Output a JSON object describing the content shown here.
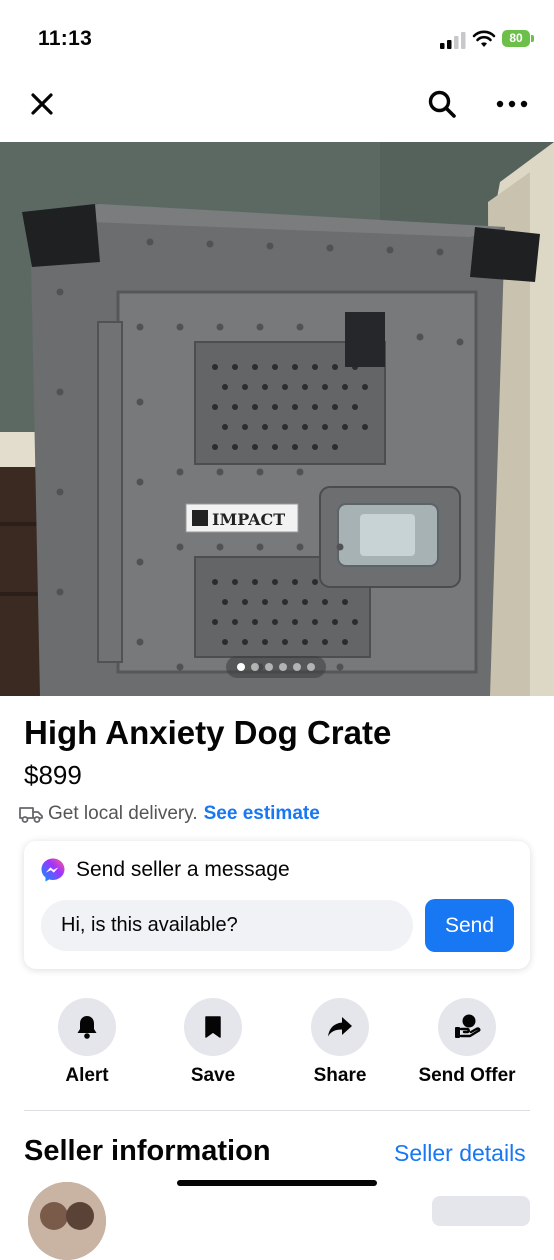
{
  "status_bar": {
    "time": "11:13",
    "battery_level": "80",
    "battery_color": "#6cc04a"
  },
  "nav": {
    "close_icon": "close-icon",
    "search_icon": "search-icon",
    "more_icon": "more-icon"
  },
  "photo": {
    "crate_label": "IMPACT",
    "carousel_count": 6,
    "carousel_active_index": 0
  },
  "listing": {
    "title": "High Anxiety Dog Crate",
    "price": "$899",
    "delivery_text": "Get local delivery.",
    "delivery_link": "See estimate"
  },
  "message": {
    "header": "Send seller a message",
    "input_value": "Hi, is this available?",
    "send_label": "Send"
  },
  "actions": [
    {
      "label": "Alert",
      "icon": "bell-icon"
    },
    {
      "label": "Save",
      "icon": "bookmark-icon"
    },
    {
      "label": "Share",
      "icon": "share-icon"
    },
    {
      "label": "Send Offer",
      "icon": "send-offer-icon"
    }
  ],
  "seller": {
    "section_title": "Seller information",
    "details_link": "Seller details"
  },
  "colors": {
    "accent": "#1877f2",
    "button_bg": "#e4e6eb",
    "input_bg": "#f0f2f5"
  }
}
